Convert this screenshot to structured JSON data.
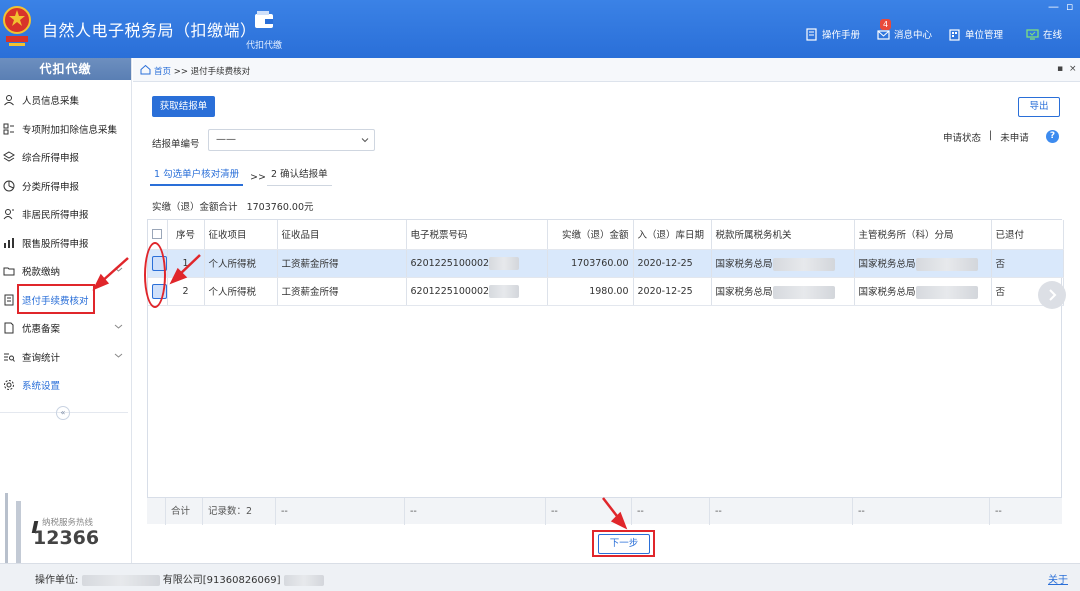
{
  "header": {
    "title": "自然人电子税务局（扣缴端）",
    "module_label": "代扣代缴",
    "links": [
      {
        "label": "操作手册",
        "icon": "manual-icon"
      },
      {
        "label": "消息中心",
        "icon": "mail-icon"
      },
      {
        "label": "单位管理",
        "icon": "building-icon"
      },
      {
        "label": "在线",
        "icon": "monitor-icon"
      }
    ],
    "message_badge": "4",
    "win_minimize": "—",
    "win_restore": "▫"
  },
  "sidebar": {
    "title": "代扣代缴",
    "items": [
      {
        "label": "人员信息采集",
        "icon": "person-icon"
      },
      {
        "label": "专项附加扣除信息采集",
        "icon": "grid-icon"
      },
      {
        "label": "综合所得申报",
        "icon": "layers-icon"
      },
      {
        "label": "分类所得申报",
        "icon": "pie-icon"
      },
      {
        "label": "非居民所得申报",
        "icon": "user-icon"
      },
      {
        "label": "限售股所得申报",
        "icon": "chart-icon"
      },
      {
        "label": "税款缴纳",
        "icon": "folder-icon"
      },
      {
        "label": "退付手续费核对",
        "icon": "receipt-icon"
      },
      {
        "label": "优惠备案",
        "icon": "doc-icon"
      },
      {
        "label": "查询统计",
        "icon": "search-list-icon"
      },
      {
        "label": "系统设置",
        "icon": "settings-icon"
      }
    ],
    "collapse_label": "«",
    "hotline_label": "纳税服务热线",
    "hotline_number": "12366"
  },
  "breadcrumb": {
    "home": "首页",
    "sep": ">>",
    "current": "退付手续费核对",
    "pin": "▪",
    "close": "×"
  },
  "toolbar": {
    "fetch_button": "获取结报单",
    "export_button": "导出"
  },
  "form": {
    "report_no_label": "结报单编号",
    "report_no_value": "——"
  },
  "status": {
    "label": "申请状态",
    "divider": "|",
    "value": "未申请",
    "help": "?"
  },
  "steps": {
    "step1": "1 勾选单户核对清册",
    "sep": ">>",
    "step2": "2 确认结报单"
  },
  "summary": {
    "label": "实缴（退）金额合计",
    "value": "1703760.00元"
  },
  "table": {
    "headers": [
      "序号",
      "征收项目",
      "征收品目",
      "电子税票号码",
      "实缴（退）金额",
      "入（退）库日期",
      "税款所属税务机关",
      "主管税务所（科）分局",
      "已退付"
    ],
    "rows": [
      {
        "no": "1",
        "item": "个人所得税",
        "category": "工资薪金所得",
        "ticket": "6201225100002",
        "amount": "1703760.00",
        "date": "2020-12-25",
        "authority": "国家税务总局",
        "branch": "国家税务总局",
        "refunded": "否"
      },
      {
        "no": "2",
        "item": "个人所得税",
        "category": "工资薪金所得",
        "ticket": "6201225100002",
        "amount": "1980.00",
        "date": "2020-12-25",
        "authority": "国家税务总局",
        "branch": "国家税务总局",
        "refunded": "否"
      }
    ],
    "total_label": "合计",
    "record_count": "记录数：2",
    "empty_cell": "--"
  },
  "next_button": "下一步",
  "footer": {
    "operator": "操作单位:",
    "company_suffix": "有限公司[91360826069]",
    "close": "关于"
  },
  "colors": {
    "header_bg": "#2a6fd8",
    "accent": "#2a6fd8",
    "selected_row": "#d9e8fb",
    "annotation": "#e0262b"
  }
}
